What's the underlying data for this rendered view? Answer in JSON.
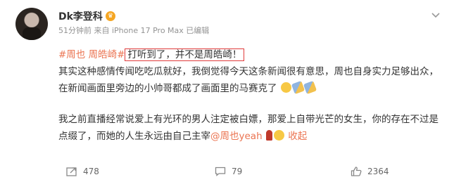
{
  "post": {
    "username": "Dk李登科",
    "meta": "51分钟前 来自 iPhone 17 Pro Max 已编辑",
    "tags": "#周也 周皓崎#",
    "boxed_text": "打听到了，并不是周皓崎！",
    "para1_rest": "其实这种感情传闻吃吃瓜就好，我倒觉得今天这条新闻很有意思，周也自身实力足够出众，在新闻画面里旁边的小帅哥都成了画面里的马赛克了",
    "para2": "我之前直播经常说爱上有光环的男人注定被白嫖，那爱上自带光芒的女生，你的存在不过是点缀了，而她的人生永远由自己主宰",
    "mention": "@周也yeah",
    "collapse": "收起"
  },
  "actions": {
    "repost": "478",
    "comment": "79",
    "like": "2364"
  },
  "icons": [
    "crown-icon",
    "more-icon",
    "repost-icon",
    "comment-icon",
    "like-icon"
  ]
}
